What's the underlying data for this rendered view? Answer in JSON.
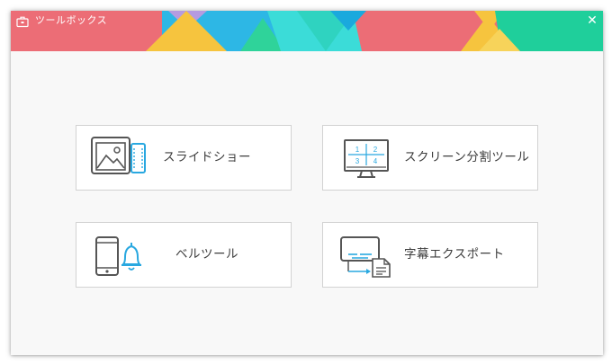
{
  "window": {
    "title": "ツールボックス",
    "close_symbol": "✕",
    "app_icon": "toolbox-icon",
    "banner_colors": [
      "#ec6d76",
      "#f6c43e",
      "#b59be0",
      "#2db7e5",
      "#2fd39a",
      "#3bdcd8",
      "#1fcf9b"
    ]
  },
  "tools": [
    {
      "label": "スライドショー",
      "icon": "slideshow-icon"
    },
    {
      "label": "スクリーン分割ツール",
      "icon": "split-screen-icon",
      "screen_numbers": [
        "1",
        "2",
        "3",
        "4"
      ]
    },
    {
      "label": "ベルツール",
      "icon": "phone-bell-icon"
    },
    {
      "label": "字幕エクスポート",
      "icon": "subtitle-export-icon"
    }
  ],
  "icon_accent_color": "#29a8e0",
  "icon_stroke_color": "#555555"
}
